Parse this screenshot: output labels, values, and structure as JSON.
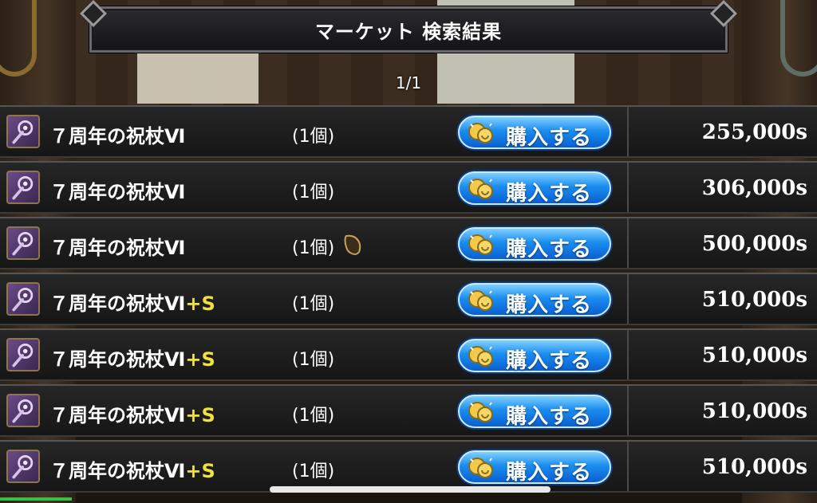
{
  "header": {
    "title": "マーケット 検索結果",
    "page_indicator": "1/1"
  },
  "listings": [
    {
      "name": "７周年の祝杖Ⅵ",
      "suffix": "",
      "quantity": "(1個)",
      "has_seed_icon": false,
      "buy_label": "購入する",
      "price": "255,000s"
    },
    {
      "name": "７周年の祝杖Ⅵ",
      "suffix": "",
      "quantity": "(1個)",
      "has_seed_icon": false,
      "buy_label": "購入する",
      "price": "306,000s"
    },
    {
      "name": "７周年の祝杖Ⅵ",
      "suffix": "",
      "quantity": "(1個)",
      "has_seed_icon": true,
      "buy_label": "購入する",
      "price": "500,000s"
    },
    {
      "name": "７周年の祝杖Ⅵ",
      "suffix": "+S",
      "quantity": "(1個)",
      "has_seed_icon": false,
      "buy_label": "購入する",
      "price": "510,000s"
    },
    {
      "name": "７周年の祝杖Ⅵ",
      "suffix": "+S",
      "quantity": "(1個)",
      "has_seed_icon": false,
      "buy_label": "購入する",
      "price": "510,000s"
    },
    {
      "name": "７周年の祝杖Ⅵ",
      "suffix": "+S",
      "quantity": "(1個)",
      "has_seed_icon": false,
      "buy_label": "購入する",
      "price": "510,000s"
    },
    {
      "name": "７周年の祝杖Ⅵ",
      "suffix": "+S",
      "quantity": "(1個)",
      "has_seed_icon": false,
      "buy_label": "購入する",
      "price": "510,000s"
    }
  ],
  "icons": {
    "item": "staff-icon",
    "buy": "coin-icon",
    "extra": "seed-icon"
  },
  "colors": {
    "buy_button": "#1a8df0",
    "suffix": "#f0e040",
    "item_icon_bg": "#6a4a86"
  }
}
